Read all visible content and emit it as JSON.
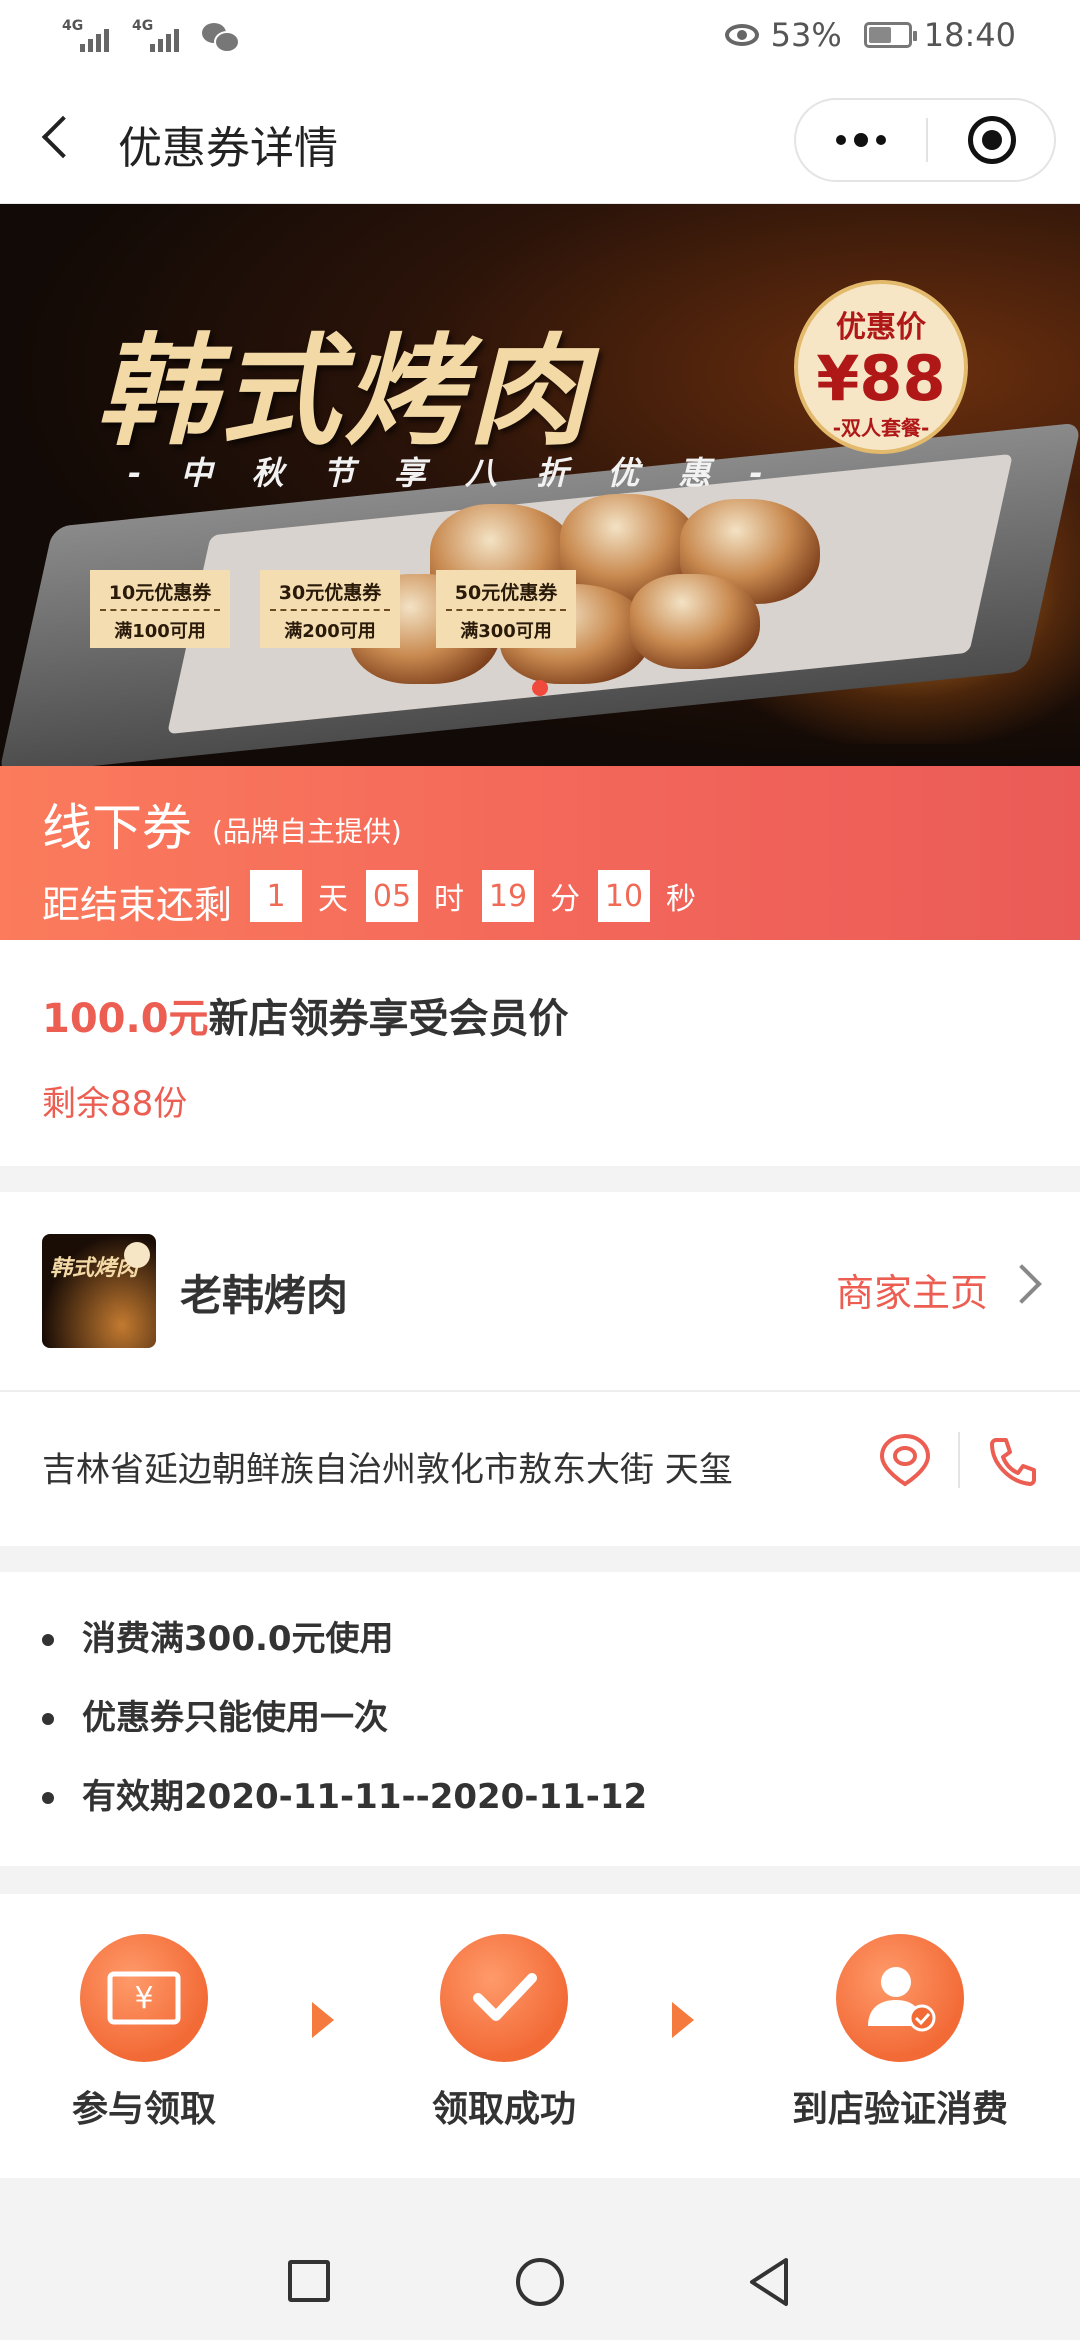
{
  "status_bar": {
    "signal_1": "4G",
    "signal_2": "4G",
    "battery_percent": "53%",
    "time": "18:40"
  },
  "nav": {
    "title": "优惠券详情"
  },
  "banner": {
    "title": "韩式烤肉",
    "subtitle": "- 中 秋 节 享 八 折 优 惠 -",
    "price_label": "优惠价",
    "price": "¥88",
    "price_note": "-双人套餐-",
    "coupons": [
      {
        "name": "10元优惠券",
        "condition": "满100可用"
      },
      {
        "name": "30元优惠券",
        "condition": "满200可用"
      },
      {
        "name": "50元优惠券",
        "condition": "满300可用"
      }
    ]
  },
  "coupon_header": {
    "title": "线下券",
    "note": "(品牌自主提供)",
    "countdown_label": "距结束还剩",
    "days": "1",
    "days_unit": "天",
    "hours": "05",
    "hours_unit": "时",
    "minutes": "19",
    "minutes_unit": "分",
    "seconds": "10",
    "seconds_unit": "秒"
  },
  "offer": {
    "amount": "100.0元",
    "description": "新店领券享受会员价",
    "remaining": "剩余88份"
  },
  "shop": {
    "logo_text": "韩式烤肉",
    "name": "老韩烤肉",
    "home_link": "商家主页",
    "address": "吉林省延边朝鲜族自治州敦化市敖东大街 天玺"
  },
  "rules": [
    "消费满300.0元使用",
    "优惠券只能使用一次",
    "有效期2020-11-11--2020-11-12"
  ],
  "steps": [
    {
      "label": "参与领取",
      "icon": "coupon-ticket-icon"
    },
    {
      "label": "领取成功",
      "icon": "checkmark-icon"
    },
    {
      "label": "到店验证消费",
      "icon": "user-verify-icon"
    }
  ],
  "colors": {
    "accent": "#ec5d52",
    "countdown_bar": "#f2655a",
    "step_orange": "#f26a36"
  }
}
